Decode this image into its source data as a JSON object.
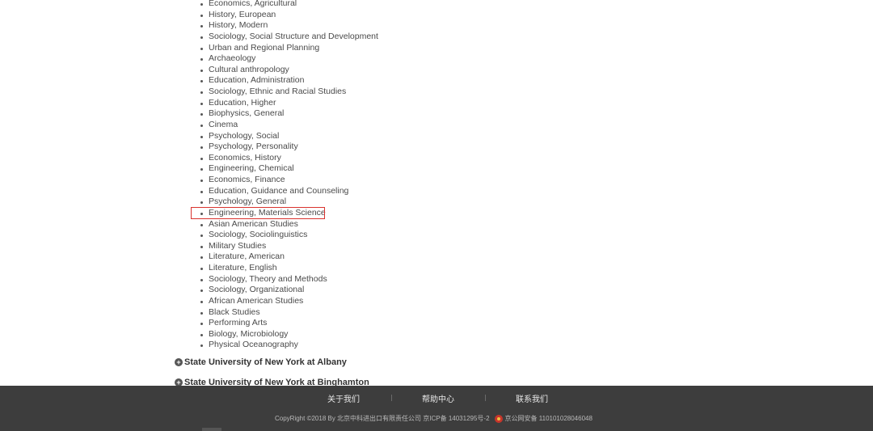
{
  "subjects": [
    "Economics, Agricultural",
    "History, European",
    "History, Modern",
    "Sociology, Social Structure and Development",
    "Urban and Regional Planning",
    "Archaeology",
    "Cultural anthropology",
    "Education, Administration",
    "Sociology, Ethnic and Racial Studies",
    "Education, Higher",
    "Biophysics, General",
    "Cinema",
    "Psychology, Social",
    "Psychology, Personality",
    "Economics, History",
    "Engineering, Chemical",
    "Economics, Finance",
    "Education, Guidance and Counseling",
    "Psychology, General",
    "Engineering, Materials Science",
    "Asian American Studies",
    "Sociology, Sociolinguistics",
    "Military Studies",
    "Literature, American",
    "Literature, English",
    "Sociology, Theory and Methods",
    "Sociology, Organizational",
    "African American Studies",
    "Black Studies",
    "Performing Arts",
    "Biology, Microbiology",
    "Physical Oceanography"
  ],
  "highlighted_subject_index": 19,
  "highlight_color": "#d9332f",
  "universities": {
    "albany": "State University of New York at Albany",
    "binghamton": "State University of New York at Binghamton"
  },
  "footer": {
    "about": "关于我们",
    "help": "帮助中心",
    "contact": "联系我们",
    "copyright": "CopyRight ©2018 By 北京中科进出口有限责任公司 京ICP备 14031295号-2",
    "police_record": "京公网安备 110101028046048",
    "background": "#3d3d3d"
  }
}
